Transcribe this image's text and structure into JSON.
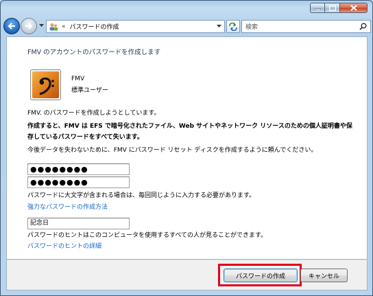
{
  "address_bar": {
    "separator": "«",
    "path": "パスワードの作成"
  },
  "search": {
    "placeholder": "検索"
  },
  "content": {
    "heading": "FMV のアカウントのパスワードを作成します",
    "user": {
      "name": "FMV",
      "type": "標準ユーザー"
    },
    "intro": "FMV. のパスワードを作成しようとしています。",
    "warning": "作成すると、FMV は EFS で暗号化されたファイル、Web サイトやネットワーク リソースのための個人証明書や保存しているパスワードをすべて失います。",
    "reset_advice": "今後データを失わないために、FMV にパスワード リセット ディスクを作成するように頼んでください。",
    "password_value": "●●●●●●●●",
    "confirm_value": "●●●●●●●●",
    "case_note": "パスワードに大文字が含まれる場合は、毎回同じように入力する必要があります。",
    "strong_password_link": "強力なパスワードの作成方法",
    "hint_value": "記念日",
    "hint_note": "パスワードのヒントはこのコンピュータを使用するすべての人が見ることができます。",
    "hint_link": "パスワードのヒントの詳細"
  },
  "buttons": {
    "create": "パスワードの作成",
    "cancel": "キャンセル"
  },
  "colors": {
    "heading": "#1e395b",
    "link": "#1565c8",
    "highlight": "#e0001b",
    "avatar": "#e07a1b"
  },
  "icons": {
    "avatar": "bass-clef-icon",
    "address": "users-icon",
    "refresh": "refresh-icon",
    "search": "search-icon"
  }
}
